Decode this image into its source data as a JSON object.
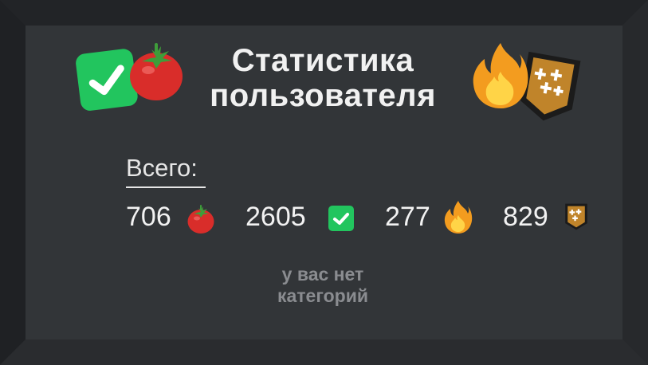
{
  "header": {
    "title_line1": "Статистика",
    "title_line2": "пользователя"
  },
  "totals": {
    "label": "Всего:",
    "items": [
      {
        "value": "706",
        "icon": "tomato-icon"
      },
      {
        "value": "2605",
        "icon": "check-icon"
      },
      {
        "value": "277",
        "icon": "fire-icon"
      },
      {
        "value": "829",
        "icon": "badge-icon"
      }
    ]
  },
  "categories": {
    "empty_line1": "у вас нет",
    "empty_line2": "категорий"
  },
  "colors": {
    "background": "#2b2d30",
    "panel": "#323538",
    "check_green": "#22c55e",
    "tomato_red": "#d92d2a",
    "badge_brown": "#b8781f",
    "muted_text": "#8a8c90"
  }
}
